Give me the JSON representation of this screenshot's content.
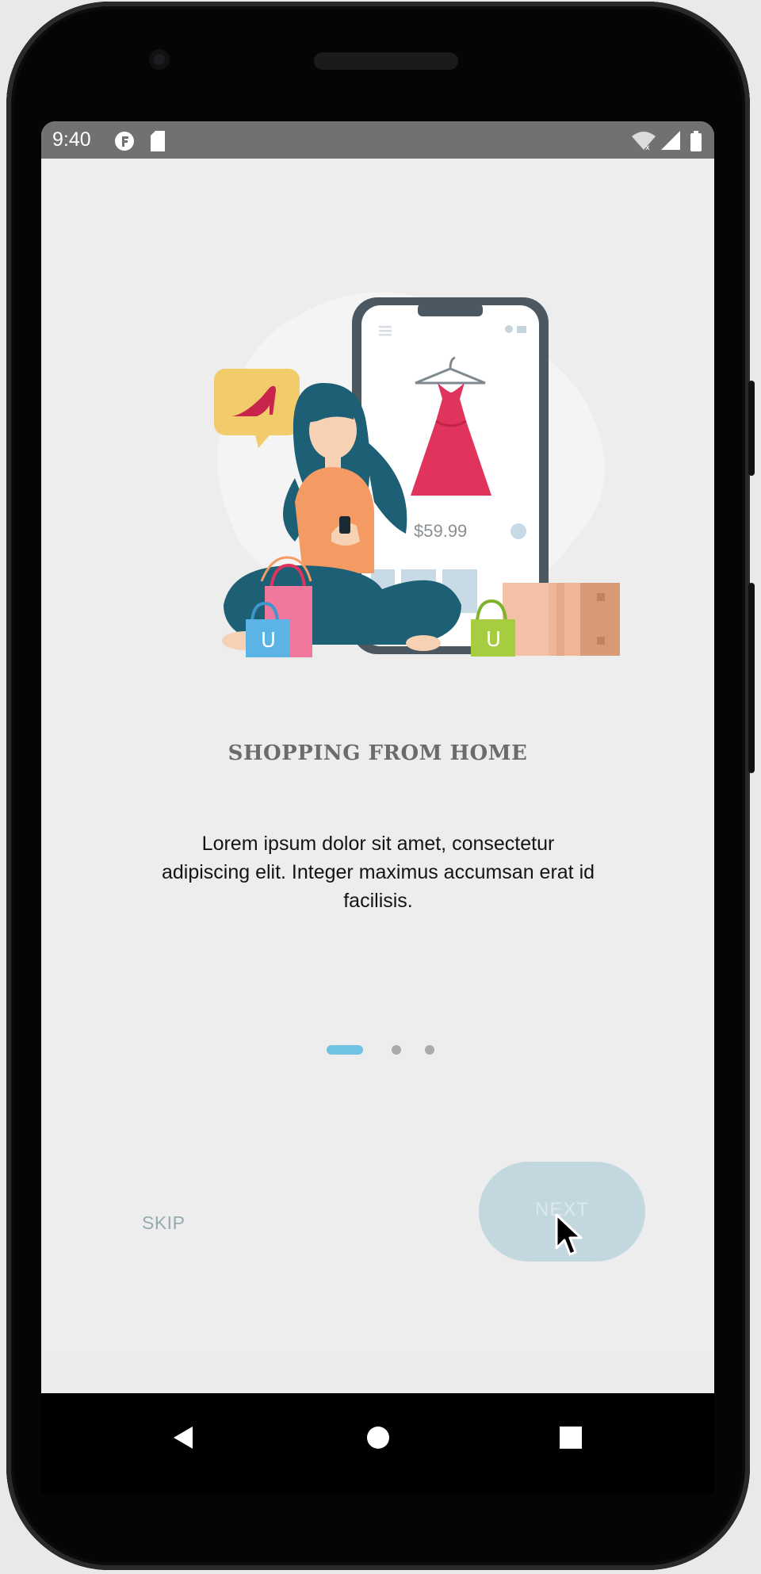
{
  "status_bar": {
    "time": "9:40",
    "icons": [
      "notification-f-icon",
      "sim-card-icon",
      "wifi-icon",
      "signal-icon",
      "battery-icon"
    ]
  },
  "illustration": {
    "price": "$59.99",
    "bag_letter": "U"
  },
  "onboarding": {
    "title": "SHOPPING FROM HOME",
    "description": "Lorem ipsum dolor sit amet, consectetur adipiscing elit. Integer maximus accumsan erat id facilisis.",
    "page_indicator": {
      "current": 1,
      "total": 3
    }
  },
  "actions": {
    "skip_label": "SKIP",
    "next_label": "NEXT"
  },
  "nav_bar": {
    "buttons": [
      "back-icon",
      "home-icon",
      "recents-icon"
    ]
  },
  "colors": {
    "accent": "#6ec2e2",
    "next_button": "#c3d8de",
    "dress": "#e0345c",
    "shoe_bubble": "#f2cc6b"
  }
}
